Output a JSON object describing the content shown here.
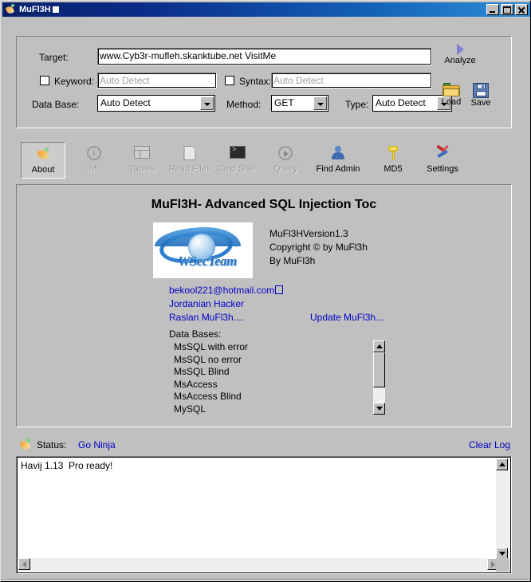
{
  "window": {
    "title": "MuFl3H",
    "title_missing_glyph": "■",
    "icon": "app-icon",
    "buttons": {
      "minimize": "_",
      "maximize": "□",
      "close": "×"
    }
  },
  "form": {
    "target_label": "Target:",
    "target_value": "www.Cyb3r-mufleh.skanktube.net VisitMe",
    "keyword_label": "Keyword:",
    "keyword_placeholder": "Auto Detect",
    "keyword_checked": false,
    "syntax_label": "Syntax:",
    "syntax_placeholder": "Auto Detect",
    "syntax_checked": false,
    "database_label": "Data Base:",
    "database_value": "Auto Detect",
    "method_label": "Method:",
    "method_value": "GET",
    "type_label": "Type:",
    "type_value": "Auto Detect"
  },
  "actions": {
    "analyze": "Analyze",
    "load": "Load",
    "save": "Save"
  },
  "tabs": [
    {
      "id": "about",
      "label": "About",
      "icon": "about-icon",
      "selected": true,
      "enabled": true
    },
    {
      "id": "info",
      "label": "Info",
      "icon": "info-icon",
      "selected": false,
      "enabled": false
    },
    {
      "id": "tables",
      "label": "Tables",
      "icon": "tables-icon",
      "selected": false,
      "enabled": false
    },
    {
      "id": "readfiles",
      "label": "Read Files",
      "icon": "document-icon",
      "selected": false,
      "enabled": false
    },
    {
      "id": "cmdshell",
      "label": "Cmd Shell",
      "icon": "terminal-icon",
      "selected": false,
      "enabled": false
    },
    {
      "id": "query",
      "label": "Query",
      "icon": "query-icon",
      "selected": false,
      "enabled": false
    },
    {
      "id": "findadmin",
      "label": "Find Admin",
      "icon": "user-icon",
      "selected": false,
      "enabled": true
    },
    {
      "id": "md5",
      "label": "MD5",
      "icon": "key-icon",
      "selected": false,
      "enabled": true
    },
    {
      "id": "settings",
      "label": "Settings",
      "icon": "tools-icon",
      "selected": false,
      "enabled": true
    }
  ],
  "about": {
    "heading": "MuFl3H- Advanced SQL Injection Toc",
    "logo_wordmark": "WSecTeam",
    "version": "MuFl3HVersion1.3",
    "copyright": "Copyright © by MuFl3h",
    "author": "By MuFl3h",
    "links": [
      {
        "text": "bekool221@hotmail.com",
        "trailing_box": true
      },
      {
        "text": "Jordanian Hacker",
        "trailing_box": false
      },
      {
        "text": "Raslan MuFl3h....",
        "trailing_box": false
      }
    ],
    "update_link": "Update MuFl3h...",
    "databases_label": "Data Bases:",
    "databases": [
      "MsSQL with error",
      "MsSQL no error",
      "MsSQL Blind",
      "MsAccess",
      "MsAccess Blind",
      "MySQL"
    ]
  },
  "status": {
    "label": "Status:",
    "value": "Go Ninja",
    "clear_log": "Clear Log"
  },
  "log": {
    "text": "Havij 1.13  Pro ready!"
  },
  "colors": {
    "title_bar_start": "#08216b",
    "title_bar_end": "#2d8ed6",
    "face": "#c0c0c0",
    "link": "#0000c8",
    "placeholder": "#a0a0a0",
    "disabled_text": "#9a9a9a"
  }
}
